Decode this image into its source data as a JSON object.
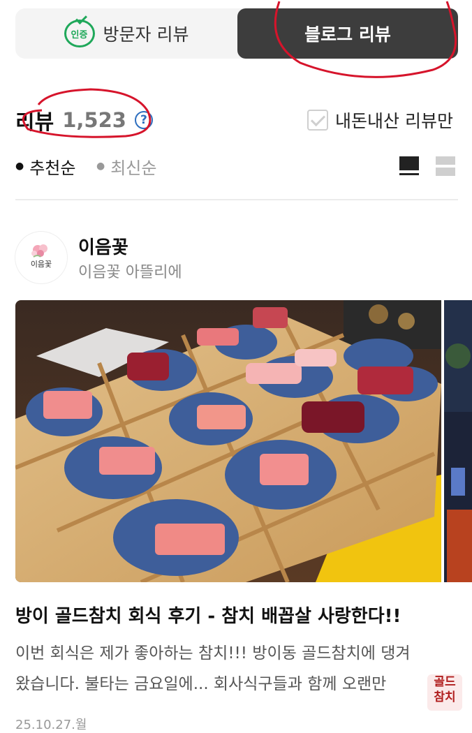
{
  "tabs": {
    "visitor": {
      "badge": "인증",
      "label": "방문자 리뷰"
    },
    "blog": {
      "label": "블로그 리뷰",
      "active": true
    }
  },
  "review_header": {
    "label": "리뷰",
    "count": "1,523",
    "help_icon": "?",
    "mine_only_label": "내돈내산 리뷰만",
    "mine_only_checked": false
  },
  "sort": {
    "options": [
      "추천순",
      "최신순"
    ],
    "selected": "추천순"
  },
  "view_modes": [
    "list-view-icon",
    "grid-view-icon"
  ],
  "post": {
    "author_name": "이음꽃",
    "author_sub": "이음꽃 아뜰리에",
    "avatar_text": "이음꽃",
    "title": "방이 골드참치 회식 후기 - 참치 배꼽살 사랑한다!!",
    "body_lines": [
      "이번 회식은 제가 좋아하는 참치!!! 방이동 골드참치에 댕겨",
      "왔습니다. 불타는 금요일에... 회사식구들과 함께 오랜만"
    ],
    "date": "25.10.27.월"
  },
  "watermark": {
    "line1": "골드",
    "line2": "참치"
  },
  "colors": {
    "active_tab": "#3d3d3d",
    "cert_green": "#1fa85a",
    "help_blue": "#2e6fbf",
    "annotation_red": "#d6142b"
  }
}
